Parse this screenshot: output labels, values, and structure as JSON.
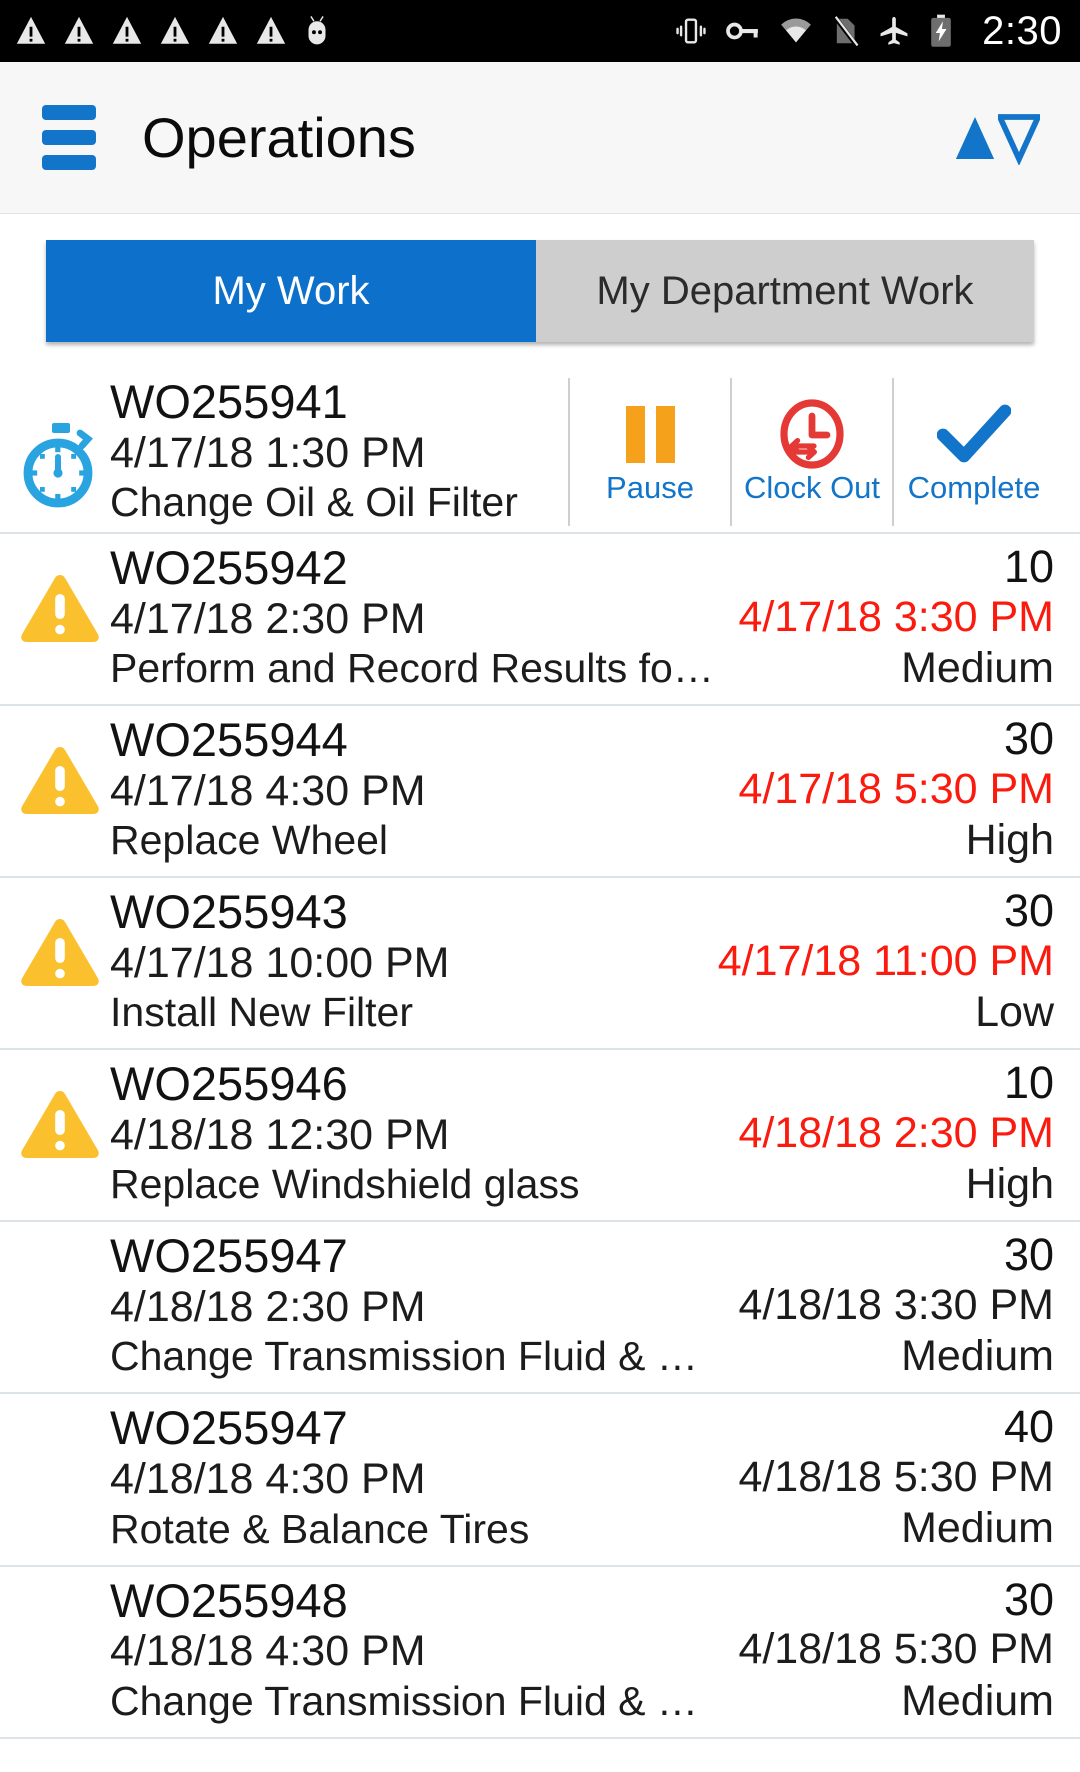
{
  "statusbar": {
    "time": "2:30",
    "icons": [
      "warning-icon",
      "warning-icon",
      "warning-icon",
      "warning-icon",
      "warning-icon",
      "warning-icon",
      "android-icon",
      "vibrate-icon",
      "vpn-key-icon",
      "wifi-icon",
      "sim-off-icon",
      "airplane-mode-icon",
      "battery-charging-icon"
    ]
  },
  "appbar": {
    "title": "Operations",
    "menu_icon": "hamburger-menu-icon",
    "sort_icon": "sort-ascending-descending-icon",
    "accent_color": "#1275c9"
  },
  "tabs": [
    {
      "label": "My Work",
      "active": true
    },
    {
      "label": "My Department Work",
      "active": false
    }
  ],
  "colors": {
    "tab_active_bg": "#0d70ca",
    "tab_inactive_bg": "#cecece",
    "overdue_text": "#fb1b0e",
    "warning_icon": "#fbc02d",
    "stopwatch_icon": "#29a4e0",
    "pause_icon": "#f5a11b",
    "clockout_icon": "#e53935",
    "complete_icon": "#1275c9",
    "link_text": "#1275c9",
    "row_divider": "#dde4e8"
  },
  "actions": [
    {
      "label": "Pause",
      "icon": "pause-icon"
    },
    {
      "label": "Clock Out",
      "icon": "clock-out-icon"
    },
    {
      "label": "Complete",
      "icon": "checkmark-icon"
    }
  ],
  "work_orders": [
    {
      "id": "WO255941",
      "start": "4/17/18 1:30 PM",
      "description": "Change Oil & Oil Filter",
      "duration": "",
      "due": "",
      "priority": "",
      "overdue": false,
      "status_icon": "stopwatch-icon",
      "has_actions": true
    },
    {
      "id": "WO255942",
      "start": "4/17/18 2:30 PM",
      "description": "Perform and Record Results for Emmisi…",
      "duration": "10",
      "due": "4/17/18 3:30 PM",
      "priority": "Medium",
      "overdue": true,
      "status_icon": "warning-icon",
      "has_actions": false
    },
    {
      "id": "WO255944",
      "start": "4/17/18 4:30 PM",
      "description": "Replace Wheel",
      "duration": "30",
      "due": "4/17/18 5:30 PM",
      "priority": "High",
      "overdue": true,
      "status_icon": "warning-icon",
      "has_actions": false
    },
    {
      "id": "WO255943",
      "start": "4/17/18 10:00 PM",
      "description": "Install New Filter",
      "duration": "30",
      "due": "4/17/18 11:00 PM",
      "priority": "Low",
      "overdue": true,
      "status_icon": "warning-icon",
      "has_actions": false
    },
    {
      "id": "WO255946",
      "start": "4/18/18 12:30 PM",
      "description": "Replace Windshield glass",
      "duration": "10",
      "due": "4/18/18 2:30 PM",
      "priority": "High",
      "overdue": true,
      "status_icon": "warning-icon",
      "has_actions": false
    },
    {
      "id": "WO255947",
      "start": "4/18/18 2:30 PM",
      "description": "Change Transmission Fluid & Filter",
      "duration": "30",
      "due": "4/18/18 3:30 PM",
      "priority": "Medium",
      "overdue": false,
      "status_icon": "",
      "has_actions": false
    },
    {
      "id": "WO255947",
      "start": "4/18/18 4:30 PM",
      "description": "Rotate & Balance Tires",
      "duration": "40",
      "due": "4/18/18 5:30 PM",
      "priority": "Medium",
      "overdue": false,
      "status_icon": "",
      "has_actions": false
    },
    {
      "id": "WO255948",
      "start": "4/18/18 4:30 PM",
      "description": "Change Transmission Fluid & Filter",
      "duration": "30",
      "due": "4/18/18 5:30 PM",
      "priority": "Medium",
      "overdue": false,
      "status_icon": "",
      "has_actions": false
    }
  ]
}
